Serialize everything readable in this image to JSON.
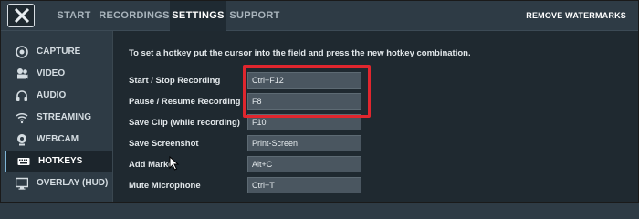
{
  "nav": {
    "tabs": [
      {
        "label": "START"
      },
      {
        "label": "RECORDINGS"
      },
      {
        "label": "SETTINGS"
      },
      {
        "label": "SUPPORT"
      }
    ],
    "active_tab": "SETTINGS",
    "remove_watermarks": "REMOVE WATERMARKS"
  },
  "sidebar": {
    "items": [
      {
        "label": "CAPTURE",
        "icon": "capture-icon"
      },
      {
        "label": "VIDEO",
        "icon": "video-icon"
      },
      {
        "label": "AUDIO",
        "icon": "headphones-icon"
      },
      {
        "label": "STREAMING",
        "icon": "wifi-icon"
      },
      {
        "label": "WEBCAM",
        "icon": "webcam-icon"
      },
      {
        "label": "HOTKEYS",
        "icon": "keyboard-icon"
      },
      {
        "label": "OVERLAY (HUD)",
        "icon": "monitor-icon"
      }
    ],
    "active_item": "HOTKEYS"
  },
  "hotkeys": {
    "hint": "To set a hotkey put the cursor into the field and press the new hotkey combination.",
    "rows": [
      {
        "label": "Start / Stop Recording",
        "value": "Ctrl+F12"
      },
      {
        "label": "Pause / Resume Recording",
        "value": "F8"
      },
      {
        "label": "Save Clip (while recording)",
        "value": "F10"
      },
      {
        "label": "Save Screenshot",
        "value": "Print-Screen"
      },
      {
        "label": "Add Marker",
        "value": "Alt+C"
      },
      {
        "label": "Mute Microphone",
        "value": "Ctrl+T"
      }
    ]
  },
  "colors": {
    "highlight": "#e0262e",
    "background": "#2e3b45",
    "panel": "#1f2930"
  }
}
